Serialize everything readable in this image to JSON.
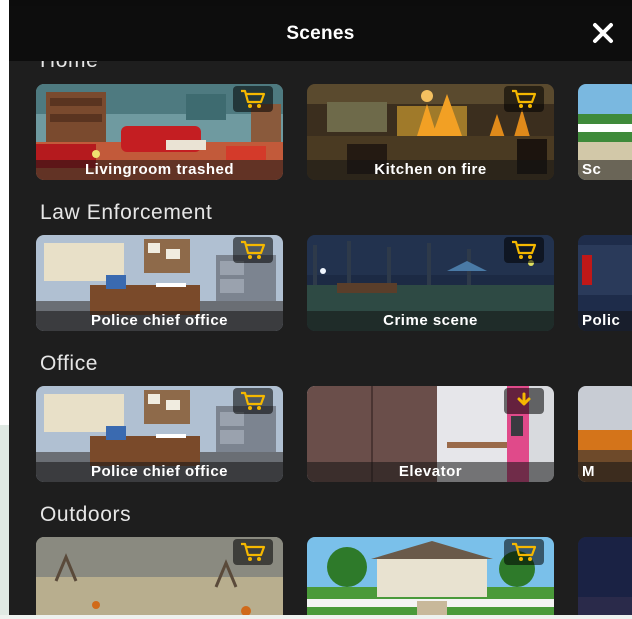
{
  "header": {
    "title": "Scenes",
    "close_icon": "close-icon"
  },
  "sections": [
    {
      "title": "Home",
      "cards": [
        {
          "label": "Livingroom trashed",
          "badge": "cart-icon"
        },
        {
          "label": "Kitchen on fire",
          "badge": "cart-icon"
        },
        {
          "label": "Sc",
          "badge": ""
        }
      ]
    },
    {
      "title": "Law Enforcement",
      "cards": [
        {
          "label": "Police chief office",
          "badge": "cart-icon"
        },
        {
          "label": "Crime scene",
          "badge": "cart-icon"
        },
        {
          "label": "Polic",
          "badge": ""
        }
      ]
    },
    {
      "title": "Office",
      "cards": [
        {
          "label": "Police chief office",
          "badge": "cart-icon"
        },
        {
          "label": "Elevator",
          "badge": "download-icon"
        },
        {
          "label": "M",
          "badge": ""
        }
      ]
    },
    {
      "title": "Outdoors",
      "cards": [
        {
          "label": "",
          "badge": "cart-icon"
        },
        {
          "label": "",
          "badge": "cart-icon"
        },
        {
          "label": "",
          "badge": ""
        }
      ]
    }
  ],
  "colors": {
    "background": "#1e1e1e",
    "header": "#0d0d0d",
    "badge_icon": "#f5b800"
  }
}
